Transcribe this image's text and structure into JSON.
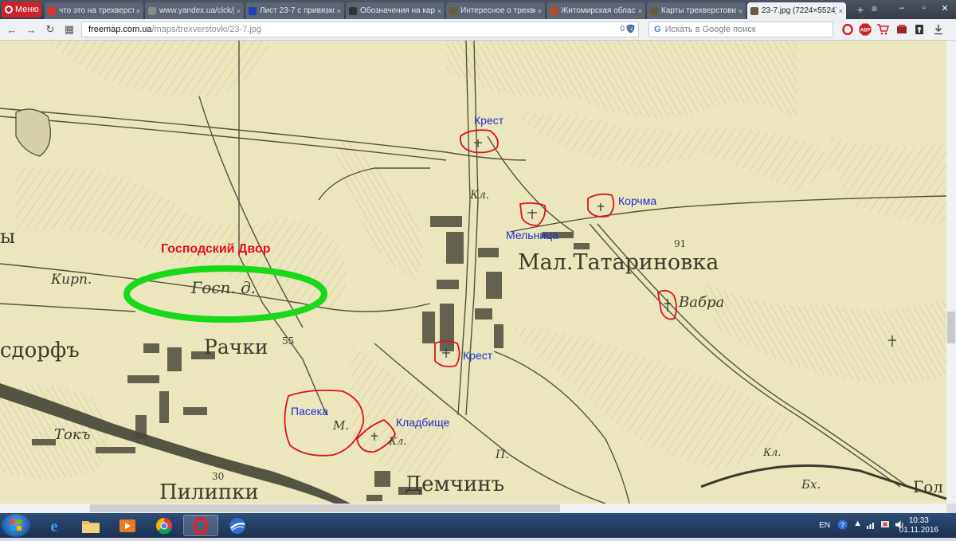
{
  "browser": {
    "menu_label": "Меню",
    "tabs": [
      {
        "label": "что это на трехверст",
        "favicon_color": "#e0302a",
        "active": false
      },
      {
        "label": "www.yandex.ua/clck/j",
        "favicon_color": "#8c8c8c",
        "active": false
      },
      {
        "label": "Лист 23-7 с привязко",
        "favicon_color": "#1d3fb8",
        "active": false
      },
      {
        "label": "Обозначения на карт",
        "favicon_color": "#333333",
        "active": false
      },
      {
        "label": "Интересное о трехве",
        "favicon_color": "#6b5a3a",
        "active": false
      },
      {
        "label": "Житомирская област",
        "favicon_color": "#b54a2c",
        "active": false
      },
      {
        "label": "Карты трехверстовки",
        "favicon_color": "#6b5a3a",
        "active": false
      },
      {
        "label": "23-7.jpg (7224×5524)",
        "favicon_color": "#6b5a3a",
        "active": true
      }
    ],
    "url_host": "freemap.com.ua",
    "url_path": "/maps/trexverstovki/23-7.jpg",
    "shield_count": "0",
    "search_placeholder": "Искать в Google поиск",
    "ext_abp": "ABP"
  },
  "map": {
    "annotations": {
      "gospodsky": "Господский Двор",
      "krest_top": "Крест",
      "korchma": "Корчма",
      "melnitsa": "Мельница",
      "krest_mid": "Крест",
      "paseka": "Пасека",
      "kladbische": "Кладбище"
    },
    "labels": {
      "mal_tatarinovka": "Мал.Татариновка",
      "rachki": "Рачки",
      "sdorf": "сдорфъ",
      "demchin": "Демчинъ",
      "pilipki": "Пилипки",
      "tokh": "Токъ",
      "kirp": "Кирп.",
      "gosp": "Госп. д.",
      "vabra": "Вабра",
      "kl_top": "Кл.",
      "kl_bottom": "Кл.",
      "kl_right": "Кл.",
      "m": "М.",
      "p": "П.",
      "n55": "55",
      "n91": "91",
      "n30": "30",
      "bkh": "Бх.",
      "gol": "Гол",
      "y": "ы"
    },
    "colors": {
      "paper": "#ece6bd",
      "ink": "#3b3a2e",
      "circle_red": "#e0101a",
      "ellipse_green": "#1ad81a",
      "annotation_blue": "#1b2fd0"
    }
  },
  "taskbar": {
    "lang": "EN",
    "time": "10:33",
    "date": "01.11.2016"
  }
}
